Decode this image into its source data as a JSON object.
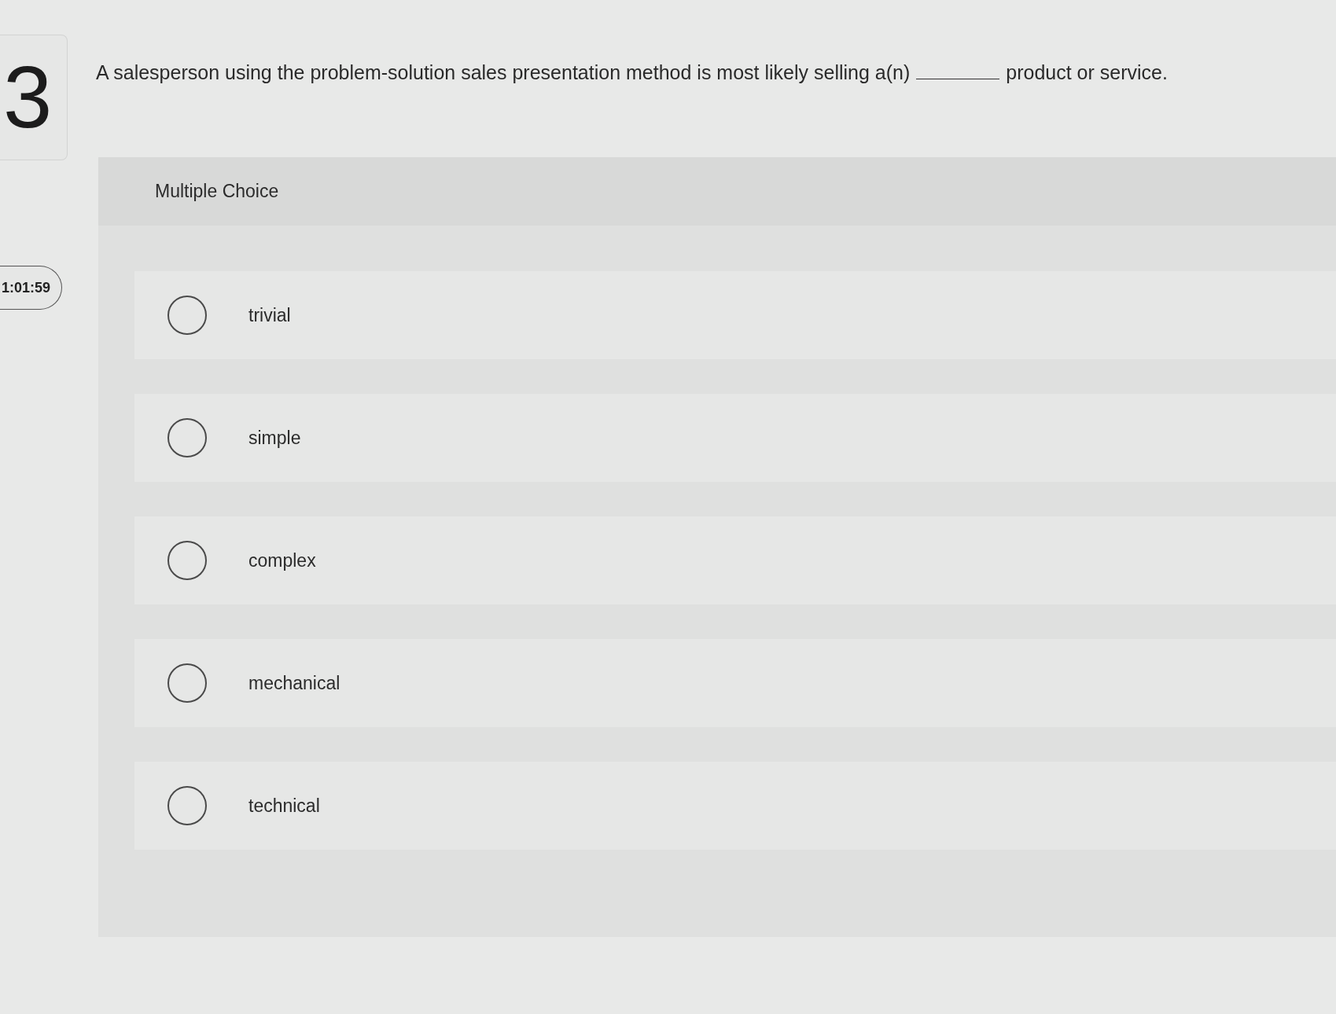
{
  "question_number": "3",
  "timer": "1:01:59",
  "question": {
    "text_before": "A salesperson using the problem-solution sales presentation method is most likely selling a(n)",
    "text_after": "product or service."
  },
  "answer_panel": {
    "title": "Multiple Choice",
    "options": [
      {
        "label": "trivial",
        "selected": false
      },
      {
        "label": "simple",
        "selected": false
      },
      {
        "label": "complex",
        "selected": false
      },
      {
        "label": "mechanical",
        "selected": false
      },
      {
        "label": "technical",
        "selected": false
      }
    ]
  }
}
